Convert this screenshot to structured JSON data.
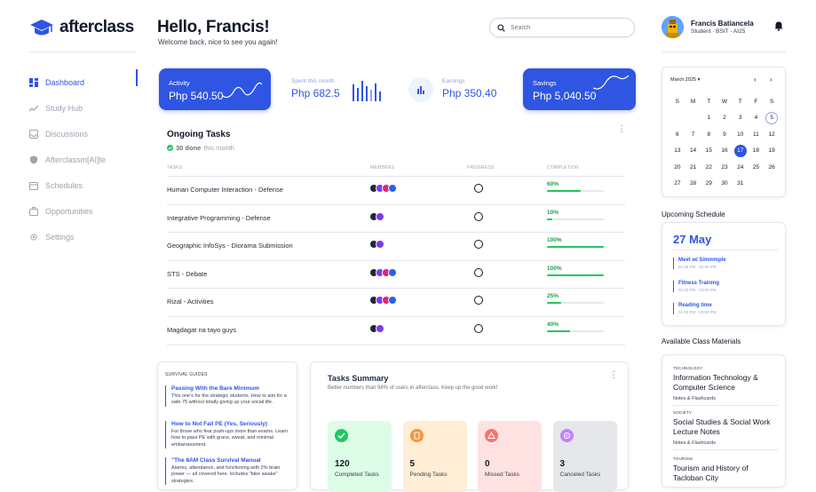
{
  "brand": {
    "name": "afterclass"
  },
  "nav": [
    {
      "label": "Dashboard",
      "icon": "dashboard-icon",
      "active": true
    },
    {
      "label": "Study Hub",
      "icon": "trend-icon"
    },
    {
      "label": "Discussions",
      "icon": "inbox-icon"
    },
    {
      "label": "Afterclassm[AI]te",
      "icon": "shield-icon"
    },
    {
      "label": "Schedules",
      "icon": "calendar-icon"
    },
    {
      "label": "Opportunities",
      "icon": "briefcase-icon"
    },
    {
      "label": "Settings",
      "icon": "gear-icon"
    }
  ],
  "header": {
    "greeting": "Hello, Francis!",
    "subtitle": "Welcome back, nice to see you again!",
    "search_placeholder": "Search"
  },
  "user": {
    "name": "Francis Batiancela",
    "role": "Student · BSIT - AI25"
  },
  "stats": {
    "activity": {
      "label": "Activity",
      "value": "Php 540.50"
    },
    "spent": {
      "label": "Spent this month",
      "value": "Php 682.5"
    },
    "earnings": {
      "label": "Earnings",
      "value": "Php 350.40"
    },
    "savings": {
      "label": "Savings",
      "value": "Php 5,040.50"
    }
  },
  "ongoing": {
    "title": "Ongoing Tasks",
    "done_count": "30 done",
    "done_suffix": "this month",
    "headers": {
      "tasks": "TASKS",
      "members": "MEMBERS",
      "progress": "PROGRESS",
      "completion": "COMPLETION"
    },
    "rows": [
      {
        "name": "Human Computer Interaction - Defense",
        "members": 4,
        "completion": "60%",
        "pct": 60
      },
      {
        "name": "Integrative Programming - Defense",
        "members": 2,
        "completion": "10%",
        "pct": 10
      },
      {
        "name": "Geographic InfoSys - Diorama Submission",
        "members": 2,
        "completion": "100%",
        "pct": 100
      },
      {
        "name": "STS - Debate",
        "members": 4,
        "completion": "100%",
        "pct": 100
      },
      {
        "name": "Rizal - Activities",
        "members": 4,
        "completion": "25%",
        "pct": 25
      },
      {
        "name": "Magdagat na tayo guys",
        "members": 2,
        "completion": "40%",
        "pct": 40
      }
    ]
  },
  "guides": {
    "title": "SURVIVAL GUIDES",
    "items": [
      {
        "title": "Passing With the Bare Minimum",
        "text": "This one's for the strategic students. How to aim for a safe 75 without totally giving up your social life."
      },
      {
        "title": "How to Not Fail PE (Yes, Seriously)",
        "text": "For those who fear push-ups more than exams. Learn how to pass PE with grace, sweat, and minimal embarrassment."
      },
      {
        "title": "\"The 8AM Class Survival Manual",
        "text": "Alarms, attendance, and functioning with 2% brain power — all covered here. Includes \"fake awake\" strategies."
      }
    ]
  },
  "summary": {
    "title": "Tasks Summary",
    "subtitle": "Better numbers than 98% of users in afterclass. Keep up the good work!",
    "tiles": [
      {
        "count": "120",
        "label": "Completed Tasks",
        "bg": "#dcfce7",
        "icon_bg": "#22c55e",
        "icon": "check-icon"
      },
      {
        "count": "5",
        "label": "Pending Tasks",
        "bg": "#ffedd5",
        "icon_bg": "#fb923c",
        "icon": "document-icon"
      },
      {
        "count": "0",
        "label": "Missed Tasks",
        "bg": "#fee2e2",
        "icon_bg": "#f87171",
        "icon": "warning-icon"
      },
      {
        "count": "3",
        "label": "Canceled Tasks",
        "bg": "#e5e7eb",
        "icon_bg": "#c084fc",
        "icon": "cancel-icon"
      }
    ]
  },
  "calendar": {
    "month": "March 2025",
    "days": [
      "S",
      "M",
      "T",
      "W",
      "T",
      "F",
      "S"
    ],
    "weeks": [
      [
        "",
        "",
        "",
        "",
        "",
        "",
        ""
      ],
      [
        "",
        "",
        "1",
        "2",
        "3",
        "4",
        "5"
      ],
      [
        "6",
        "7",
        "8",
        "9",
        "10",
        "11",
        "12"
      ],
      [
        "13",
        "14",
        "15",
        "16",
        "17",
        "18",
        "19"
      ],
      [
        "20",
        "21",
        "22",
        "23",
        "24",
        "25",
        "26"
      ],
      [
        "27",
        "28",
        "29",
        "30",
        "31",
        "",
        ""
      ]
    ],
    "selected": "17",
    "today": "5"
  },
  "schedule": {
    "title": "Upcoming Schedule",
    "date": "27 May",
    "events": [
      {
        "title": "Meet w/ Simmmple",
        "time": "01:00 PM - 02:00 PM"
      },
      {
        "title": "Fitness Training",
        "time": "02:00 PM - 03:00 PM"
      },
      {
        "title": "Reading time",
        "time": "01:00 PM - 02:00 PM"
      }
    ]
  },
  "materials": {
    "title": "Available Class Materials",
    "items": [
      {
        "category": "TECHNOLOGY",
        "title": "Information Technology & Computer Science",
        "link": "Notes & Flashcards"
      },
      {
        "category": "SOCIETY",
        "title": "Social Studies & Social Work Lecture Notes",
        "link": "Notes & Flashcards"
      },
      {
        "category": "TOURISM",
        "title": "Tourism and History of Tacloban City",
        "link": ""
      }
    ]
  },
  "colors": {
    "accent": "#2f55e3",
    "success": "#22c55e"
  }
}
